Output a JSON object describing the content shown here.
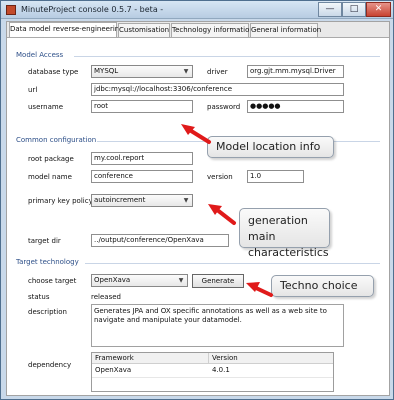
{
  "window": {
    "title": "MinuteProject console 0.5.7 - beta -",
    "controls": [
      "—",
      "□",
      "✕"
    ]
  },
  "tabs": [
    {
      "label": "Data model reverse-engineering",
      "active": true
    },
    {
      "label": "Customisation",
      "active": false
    },
    {
      "label": "Technology information",
      "active": false
    },
    {
      "label": "General information",
      "active": false
    }
  ],
  "model_access": {
    "title": "Model Access",
    "database_type_label": "database type",
    "database_type_value": "MYSQL",
    "driver_label": "driver",
    "driver_value": "org.gjt.mm.mysql.Driver",
    "url_label": "url",
    "url_value": "jdbc:mysql://localhost:3306/conference",
    "username_label": "username",
    "username_value": "root",
    "password_label": "password",
    "password_value": "●●●●●"
  },
  "common_configuration": {
    "title": "Common configuration",
    "root_package_label": "root package",
    "root_package_value": "my.cool.report",
    "model_name_label": "model name",
    "model_name_value": "conference",
    "version_label": "version",
    "version_value": "1.0",
    "primary_key_policy_label": "primary key policy",
    "primary_key_policy_value": "autoincrement",
    "target_dir_label": "target dir",
    "target_dir_value": "../output/conference/OpenXava"
  },
  "target_technology": {
    "title": "Target technology",
    "choose_target_label": "choose target",
    "choose_target_value": "OpenXava",
    "generate_label": "Generate",
    "status_label": "status",
    "status_value": "released",
    "description_label": "description",
    "description_value": "Generates JPA and OX specific annotations as well as a web site to navigate and manipulate your datamodel.",
    "dependency_label": "dependency",
    "dependency_table": {
      "headers": [
        "Framework",
        "Version"
      ],
      "rows": [
        [
          "OpenXava",
          "4.0.1"
        ]
      ]
    }
  },
  "callouts": {
    "model_location": "Model location info",
    "generation": "generation main characteristics",
    "techno": "Techno choice"
  },
  "colors": {
    "section_title": "#2d4f88",
    "arrow": "#e01a1a",
    "window_frame": "#c9d9ea"
  }
}
